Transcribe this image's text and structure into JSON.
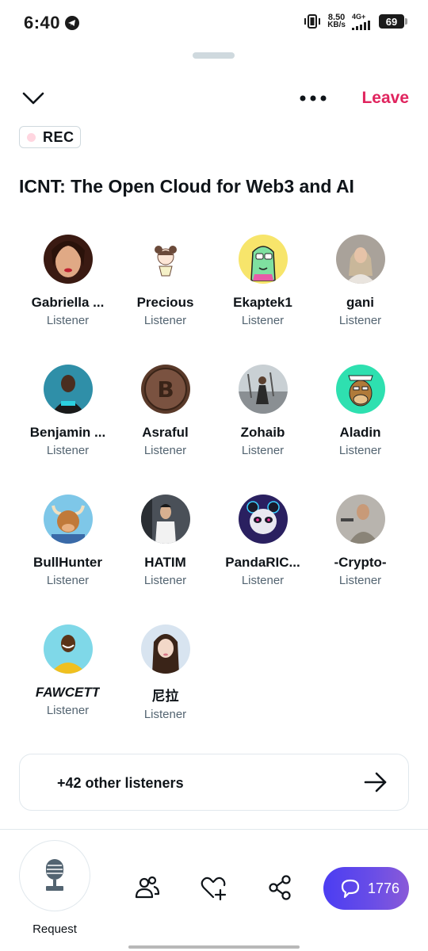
{
  "status_bar": {
    "time": "6:40",
    "net_speed_value": "8.50",
    "net_speed_unit": "KB/s",
    "network_type": "4G+",
    "battery": "69"
  },
  "header": {
    "leave_label": "Leave",
    "rec_label": "REC"
  },
  "space": {
    "title": "ICNT: The Open Cloud for Web3 and AI"
  },
  "participants": [
    {
      "name": "Gabriella ...",
      "role": "Listener",
      "avatar": "woman-portrait-avatar"
    },
    {
      "name": "Precious",
      "role": "Listener",
      "avatar": "cartoon-girl-avatar"
    },
    {
      "name": "Ekaptek1",
      "role": "Listener",
      "avatar": "green-cartoon-avatar"
    },
    {
      "name": "gani",
      "role": "Listener",
      "avatar": "woman-photo-avatar"
    },
    {
      "name": "Benjamin ...",
      "role": "Listener",
      "avatar": "man-crypto-avatar"
    },
    {
      "name": "Asraful",
      "role": "Listener",
      "avatar": "bitcoin-coin-avatar"
    },
    {
      "name": "Zohaib",
      "role": "Listener",
      "avatar": "man-outdoor-avatar"
    },
    {
      "name": "Aladin",
      "role": "Listener",
      "avatar": "ape-nft-avatar"
    },
    {
      "name": "BullHunter",
      "role": "Listener",
      "avatar": "bull-cartoon-avatar"
    },
    {
      "name": "HATIM",
      "role": "Listener",
      "avatar": "man-street-avatar"
    },
    {
      "name": "PandaRIC...",
      "role": "Listener",
      "avatar": "panda-robot-avatar"
    },
    {
      "name": "-Crypto-",
      "role": "Listener",
      "avatar": "man-gym-avatar"
    },
    {
      "name": "FAWCETT",
      "role": "Listener",
      "avatar": "man-yellow-shirt-avatar"
    },
    {
      "name": "尼拉",
      "role": "Listener",
      "avatar": "woman-selfie-avatar"
    }
  ],
  "others": {
    "label": "+42 other listeners"
  },
  "bottom_bar": {
    "request_label": "Request",
    "chat_count": "1776",
    "accent_color": "#4b3df2",
    "leave_color": "#e0245e"
  }
}
